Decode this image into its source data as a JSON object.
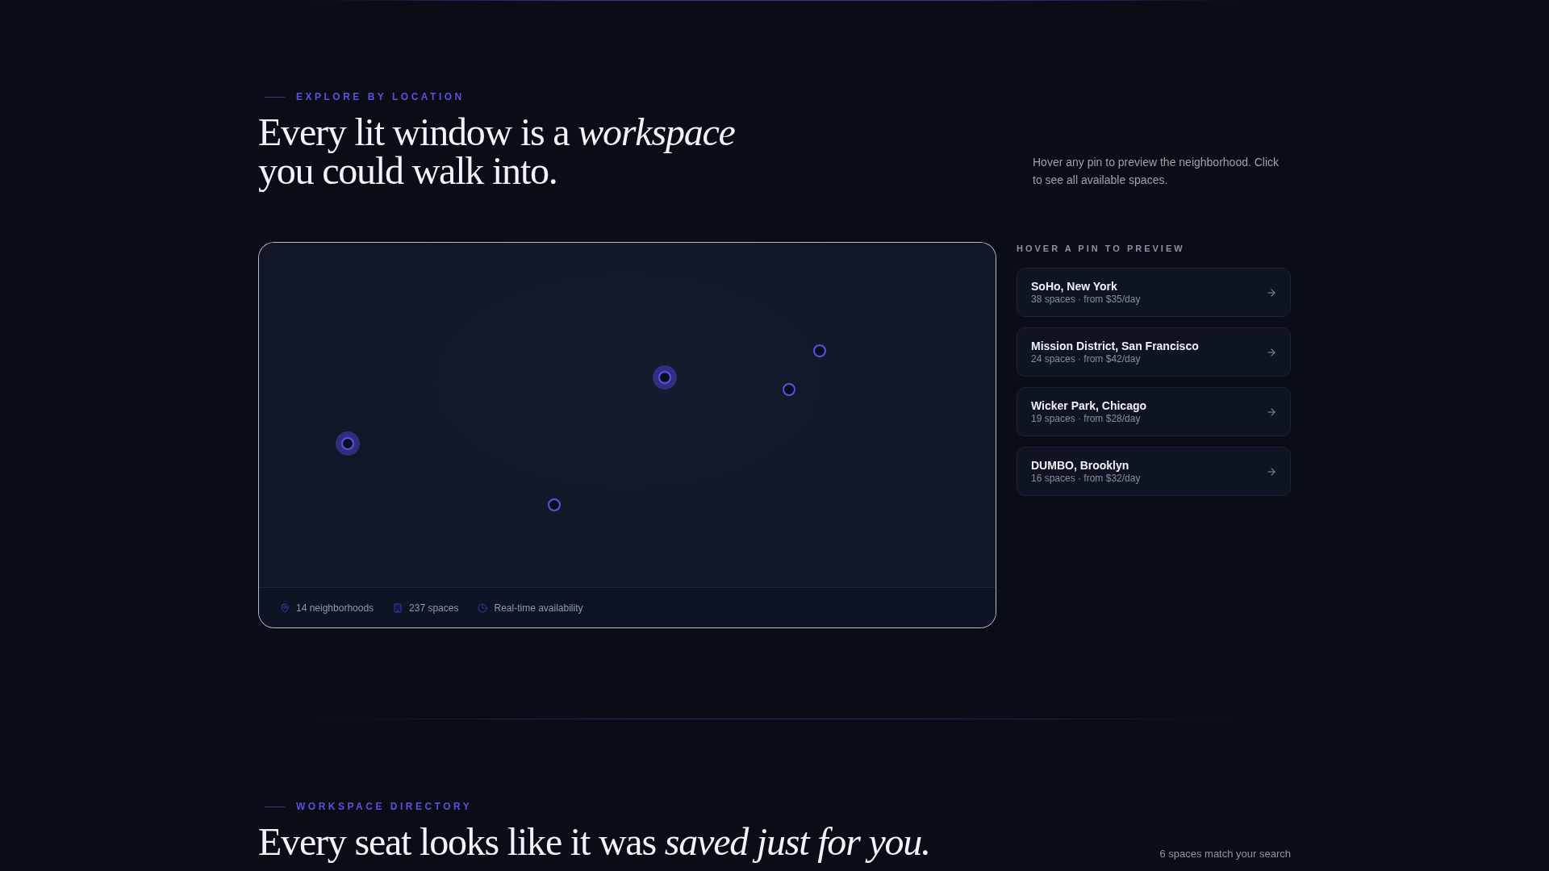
{
  "location_section": {
    "eyebrow": "EXPLORE BY LOCATION",
    "heading": "Every lit window is a *workspace* you could walk into.",
    "description": "Hover any pin to preview the neighborhood. Click to see all available spaces.",
    "map": {
      "pins": [
        {
          "highlighted": true
        },
        {
          "highlighted": true
        },
        {
          "highlighted": false
        },
        {
          "highlighted": false
        },
        {
          "highlighted": false
        }
      ],
      "stats": [
        "14 neighborhoods",
        "237 spaces",
        "Real-time availability"
      ]
    },
    "preview_list": {
      "label": "HOVER A PIN TO PREVIEW",
      "items": [
        {
          "name": "SoHo, New York",
          "details": "38 spaces · from $35/day"
        },
        {
          "name": "Mission District, San Francisco",
          "details": "24 spaces · from $42/day"
        },
        {
          "name": "Wicker Park, Chicago",
          "details": "19 spaces · from $28/day"
        },
        {
          "name": "DUMBO, Brooklyn",
          "details": "16 spaces · from $32/day"
        }
      ]
    }
  },
  "directory_section": {
    "eyebrow": "WORKSPACE DIRECTORY",
    "heading": "Every seat looks like it was *saved just for you.*",
    "result_count": "6 spaces match your search"
  }
}
